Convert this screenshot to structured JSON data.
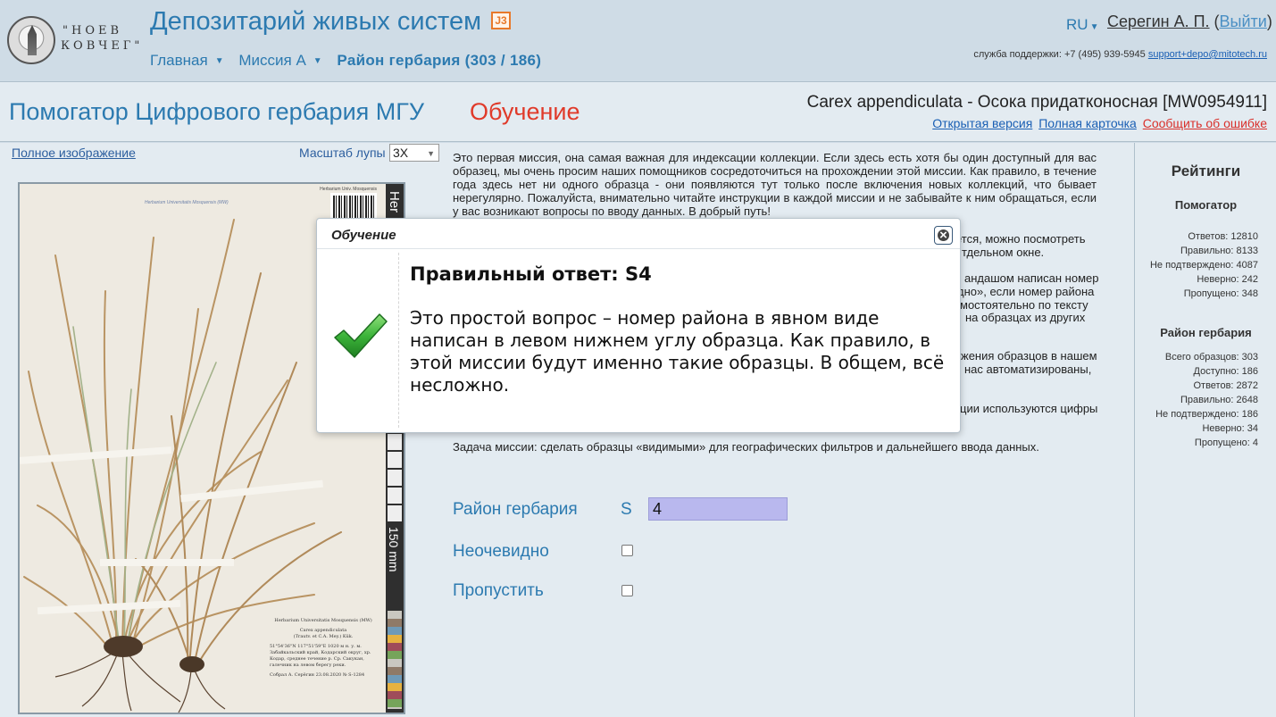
{
  "header": {
    "logo_line1": "\"НОЕВ",
    "logo_line2": "КОВЧЕГ\"",
    "site_title": "Депозитарий живых систем",
    "j3_badge": "J3",
    "nav": {
      "home": "Главная",
      "mission": "Миссия А",
      "current": "Район гербария (303 / 186)"
    },
    "lang": "RU",
    "user_name": "Серегин А. П.",
    "logout_open": " (",
    "logout_label": "Выйти",
    "logout_close": ")",
    "support_label": "служба поддержки: +7 (495) 939-5945",
    "support_email": "support+depo@mitotech.ru"
  },
  "subheader": {
    "page_title": "Помогатор Цифрового гербария МГУ",
    "mode": "Обучение",
    "specimen": "Carex appendiculata - Осока придатконосная [MW0954911]",
    "links": {
      "open_version": "Открытая версия",
      "full_card": "Полная карточка",
      "report_error": "Сообщить об ошибке"
    }
  },
  "image_panel": {
    "full_image_link": "Полное изображение",
    "zoom_label": "Масштаб лупы",
    "zoom_value": "3X",
    "ruler_text_top": "Her",
    "ruler_text_scale": "150 mm",
    "barcode_caption": "Herbarium Univ. Mosquensis",
    "sheet_header": "Herbarium Universitatis Mosquensis (MW)",
    "label": {
      "institution": "Herbarium Universitatis Mosquensis (MW)",
      "taxon": "Carex appendiculata",
      "author": "(Trautv. et C.A. Mey.) Kük.",
      "coords": "51°54'36\"N 117°51'59\"E",
      "altitude": "1020 м н. у. м.",
      "locality": "Забайкальский край, Кодарский округ, хр. Кодар, среднее течение р. Ср. Сакукан, галечник на левом берегу реки.",
      "collector": "Собрал А. Серёгин",
      "date": "23.08.2020",
      "number": "№ S-1284"
    }
  },
  "intro_text": "Это первая миссия, она самая важная для индексации коллекции. Если здесь есть хотя бы один доступный для вас образец, мы очень просим наших помощников сосредоточиться на прохождении этой миссии. Как правило, в течение года здесь нет ни одного образца - они появляются тут только после включения новых коллекций, что бывает нерегулярно. Пожалуйста, внимательно читайте инструкции в каждой миссии и не забывайте к ним обращаться, если у вас возникают вопросы по вводу данных. В добрый путь!",
  "partial_lines": {
    "p1a": "ется, можно посмотреть",
    "p1b": "тдельном окне.",
    "p2a": "андашом написан номер",
    "p2b": "дно», если номер района",
    "p2c": "мостоятельно по тексту",
    "p2d": "на образцах из других",
    "p3a": "жения образцов в нашем",
    "p3b": "нас автоматизированы,",
    "p4a": "ции используются цифры"
  },
  "task_text": "Задача миссии: сделать образцы «видимыми» для географических фильтров и дальнейшего ввода данных.",
  "form": {
    "district_label": "Район гербария",
    "prefix": "S",
    "district_value": "4",
    "unclear_label": "Неочевидно",
    "skip_label": "Пропустить"
  },
  "ratings": {
    "title": "Рейтинги",
    "helper_title": "Помогатор",
    "helper_stats": [
      "Ответов: 12810",
      "Правильно: 8133",
      "Не подтверждено: 4087",
      "Неверно: 242",
      "Пропущено: 348"
    ],
    "district_title": "Район гербария",
    "district_stats": [
      "Всего образцов: 303",
      "Доступно: 186",
      "Ответов: 2872",
      "Правильно: 2648",
      "Не подтверждено: 186",
      "Неверно: 34",
      "Пропущено: 4"
    ]
  },
  "modal": {
    "title": "Обучение",
    "answer_title": "Правильный ответ: S4",
    "answer_text": "Это простой вопрос – номер района в явном виде написан в левом нижнем углу образца. Как правило, в этой миссии будут именно такие образцы. В общем, всё несложно."
  },
  "colors": {
    "accent_blue": "#2c7ab0",
    "mode_red": "#e03a2a",
    "input_fill": "#b9b8ee",
    "check_green": "#3cb43a"
  },
  "icons": {
    "success": "green-checkmark-icon",
    "close": "close-icon",
    "caret": "chevron-down-icon"
  }
}
